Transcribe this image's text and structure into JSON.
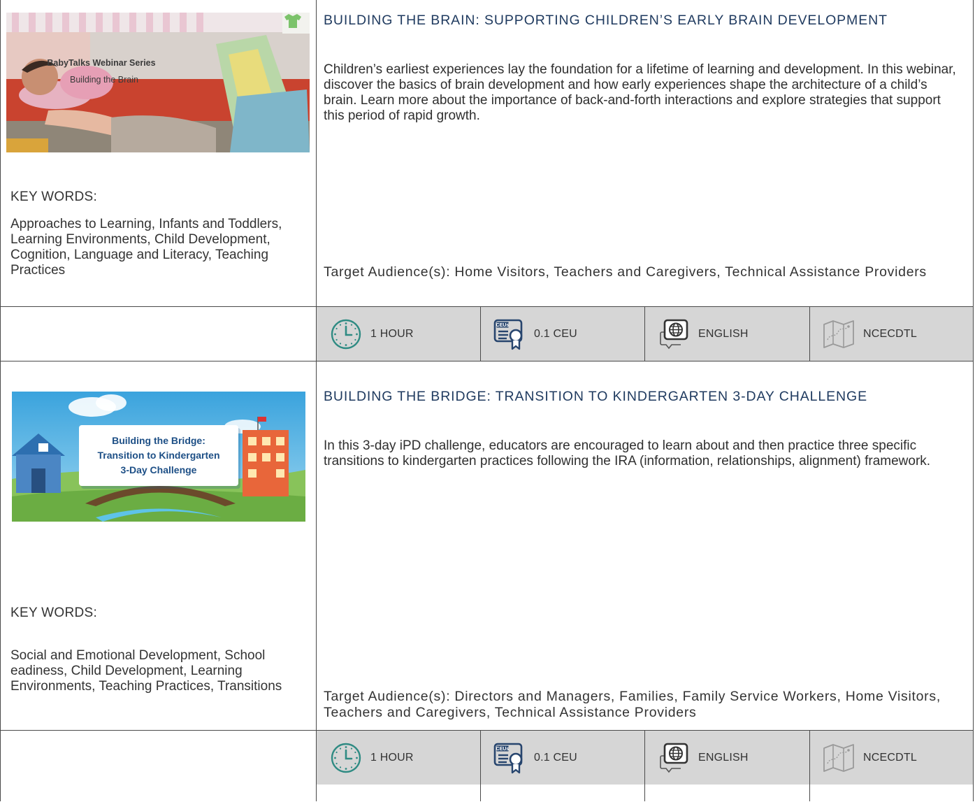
{
  "courses": [
    {
      "thumb": {
        "line1": "BabyTalks Webinar Series",
        "line2": "Building the Brain"
      },
      "title": "BUILDING THE BRAIN: SUPPORTING CHILDREN’S EARLY BRAIN DEVELOPMENT",
      "description": "Children’s earliest experiences lay the foundation for a lifetime of learning and development. In this webinar, discover the basics of brain development and how early experiences shape the architecture of a child’s brain. Learn more about the importance of back-and-forth interactions and explore strategies that support this period of rapid growth.",
      "keywords_label": "KEY WORDS:",
      "keywords": "Approaches to Learning, Infants and Toddlers, Learning Environments, Child Development, Cognition, Language and Literacy, Teaching Practices",
      "audience": "Target Audience(s): Home Visitors, Teachers and Caregivers, Technical Assistance Providers",
      "meta": {
        "duration": "1 HOUR",
        "ceu": "0.1 CEU",
        "language": "ENGLISH",
        "provider": "NCECDTL"
      }
    },
    {
      "thumb": {
        "line1": "Building the Bridge:",
        "line2": "Transition to Kindergarten",
        "line3": "3-Day Challenge"
      },
      "title": "BUILDING THE BRIDGE: TRANSITION TO KINDERGARTEN 3-DAY CHALLENGE",
      "description": "In this 3-day iPD challenge, educators are encouraged to learn about and then practice three specific transitions to kindergarten practices following the IRA (information, relationships, alignment) framework.",
      "keywords_label": "KEY WORDS:",
      "keywords": "Social and Emotional Development, School eadiness, Child Development, Learning Environments, Teaching Practices, Transitions",
      "audience": "Target Audience(s): Directors and Managers, Families, Family Service Workers, Home Visitors, Teachers and Caregivers, Technical Assistance Providers",
      "meta": {
        "duration": "1 HOUR",
        "ceu": "0.1 CEU",
        "language": "ENGLISH",
        "provider": "NCECDTL"
      }
    }
  ],
  "icons": {
    "duration": "clock-icon",
    "ceu": "ceu-certificate-icon",
    "language": "globe-speech-icon",
    "provider": "map-icon"
  },
  "colors": {
    "title": "#1f3a5f",
    "teal_icon": "#2f8b83",
    "navy_icon": "#27456e",
    "gray_icon": "#9a9a9a",
    "meta_bg": "#d6d6d6"
  },
  "ceu_badge_text": "CEUs"
}
